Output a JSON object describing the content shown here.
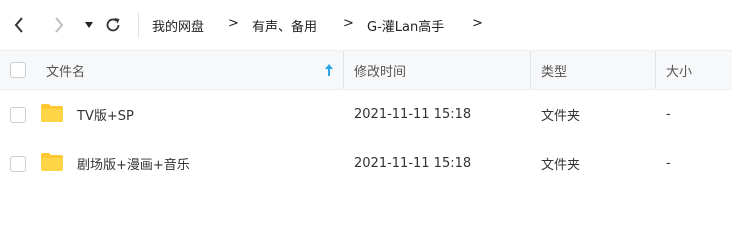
{
  "nav": {
    "back_icon": "chevron-left-icon",
    "forward_icon": "chevron-right-icon",
    "dropdown_icon": "caret-down-icon",
    "refresh_icon": "refresh-icon"
  },
  "breadcrumb": {
    "items": [
      "我的网盘",
      "有声、备用",
      "G-灌Lan高手"
    ],
    "separator": ">"
  },
  "table": {
    "headers": {
      "name": "文件名",
      "modified": "修改时间",
      "type": "类型",
      "size": "大小"
    },
    "sort_icon": "sort-up-arrow-icon",
    "rows": [
      {
        "name": "TV版+SP",
        "modified": "2021-11-11 15:18",
        "type": "文件夹",
        "size": "-"
      },
      {
        "name": "剧场版+漫画+音乐",
        "modified": "2021-11-11 15:18",
        "type": "文件夹",
        "size": "-"
      }
    ]
  },
  "colors": {
    "accent": "#2aa7e8",
    "folder": "#ffc832",
    "header_bg": "#f7f8fa"
  }
}
